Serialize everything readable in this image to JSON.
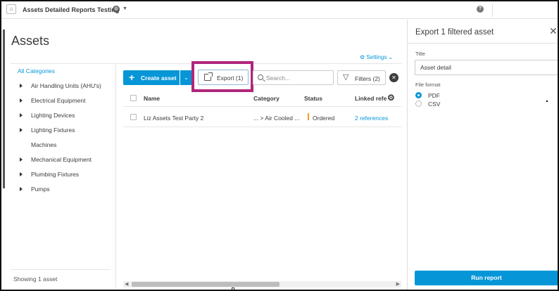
{
  "topbar": {
    "logo": "⌂",
    "project_name": "Assets Detailed Reports Testing",
    "globe_icon": "globe-icon",
    "caret": "▼",
    "help": "?"
  },
  "page": {
    "title": "Assets",
    "settings_label": "Settings",
    "settings_icon": "⚙",
    "settings_caret": "⌄"
  },
  "categories": {
    "all_label": "All Categories",
    "items": [
      {
        "label": "Air Handling Units (AHU's)",
        "expandable": true
      },
      {
        "label": "Electrical Equipment",
        "expandable": true
      },
      {
        "label": "Lighting Devices",
        "expandable": true
      },
      {
        "label": "Lighting Fixtures",
        "expandable": true
      },
      {
        "label": "Machines",
        "expandable": false
      },
      {
        "label": "Mechanical Equipment",
        "expandable": true
      },
      {
        "label": "Plumbing Fixtures",
        "expandable": true
      },
      {
        "label": "Pumps",
        "expandable": true
      }
    ],
    "showing": "Showing 1 asset"
  },
  "toolbar": {
    "create_plus": "+",
    "create_label": "Create asset",
    "create_caret": "⌄",
    "export_label": "Export (1)",
    "search_placeholder": "Search...",
    "filters_icon": "▽",
    "filters_label": "Filters (2)",
    "clear_icon": "✕"
  },
  "table": {
    "headers": [
      "Name",
      "Category",
      "Status",
      "Linked refe"
    ],
    "gear_icon": "⚙",
    "rows": [
      {
        "name": "Liz Assets Test Party 2",
        "category": "... > Air Cooled ...",
        "status": "Ordered",
        "linked": "2 references"
      }
    ]
  },
  "scroll": {
    "left_arrow": "◀",
    "right_arrow": "▶"
  },
  "panel": {
    "title": "Export 1 filtered asset",
    "close_icon": "✕",
    "title_label": "Title",
    "title_value": "Asset detail",
    "format_label": "File format",
    "formats": [
      {
        "label": "PDF",
        "selected": true
      },
      {
        "label": "CSV",
        "selected": false
      }
    ],
    "run_label": "Run report"
  },
  "colors": {
    "accent": "#0696d7",
    "highlight": "#b0267a",
    "status_ordered": "#f29b1d"
  }
}
